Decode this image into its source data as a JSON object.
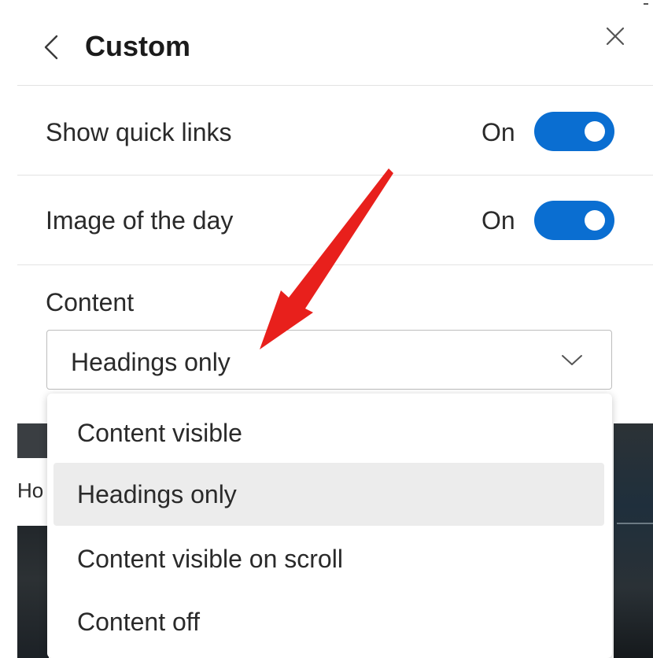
{
  "header": {
    "title": "Custom"
  },
  "settings": {
    "quick_links": {
      "label": "Show quick links",
      "state": "On"
    },
    "image_of_day": {
      "label": "Image of the day",
      "state": "On"
    }
  },
  "content": {
    "label": "Content",
    "selected_value": "Headings only",
    "options": [
      "Content visible",
      "Headings only",
      "Content visible on scroll",
      "Content off"
    ]
  },
  "background": {
    "partial_text": "Ho"
  },
  "colors": {
    "accent": "#0a6ed1",
    "annotation_arrow": "#e8201c",
    "selected_option_bg": "#ececec"
  }
}
